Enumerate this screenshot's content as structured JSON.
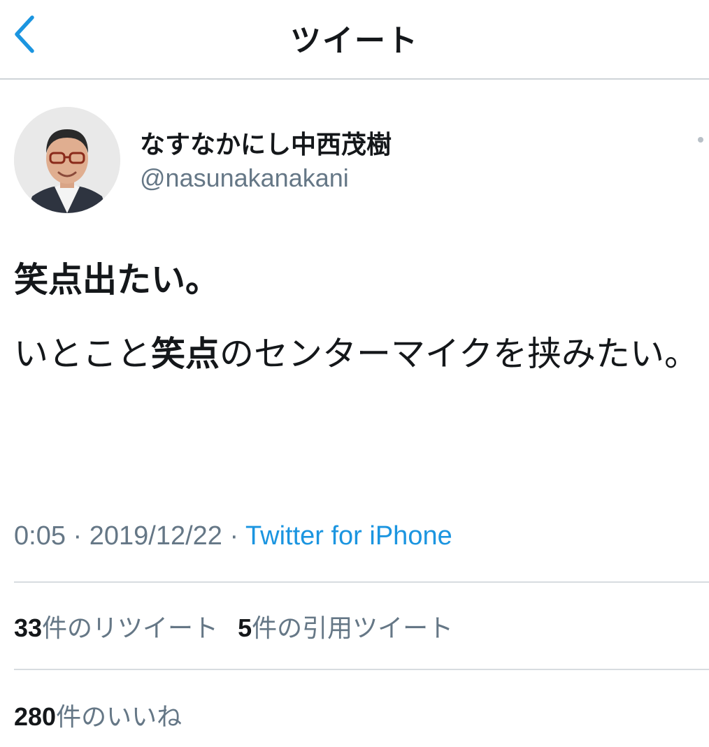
{
  "nav": {
    "title": "ツイート",
    "back_icon": "chevron-left-icon",
    "accent_color": "#1b95e0"
  },
  "user": {
    "name": "なすなかにし中西茂樹",
    "handle": "@nasunakanakani"
  },
  "tweet": {
    "line1": "笑点出たい。",
    "line2_part1": "いとこと",
    "line2_highlight": "笑点",
    "line2_part2": "のセンターマイクを挟みたい。"
  },
  "meta": {
    "time": "0:05",
    "separator": " · ",
    "date": "2019/12/22",
    "source": "Twitter for iPhone"
  },
  "stats": {
    "retweets_count": "33",
    "retweets_label": "件のリツイート",
    "quotes_count": "5",
    "quotes_label": "件の引用ツイート",
    "likes_count": "280",
    "likes_label": "件のいいね"
  }
}
